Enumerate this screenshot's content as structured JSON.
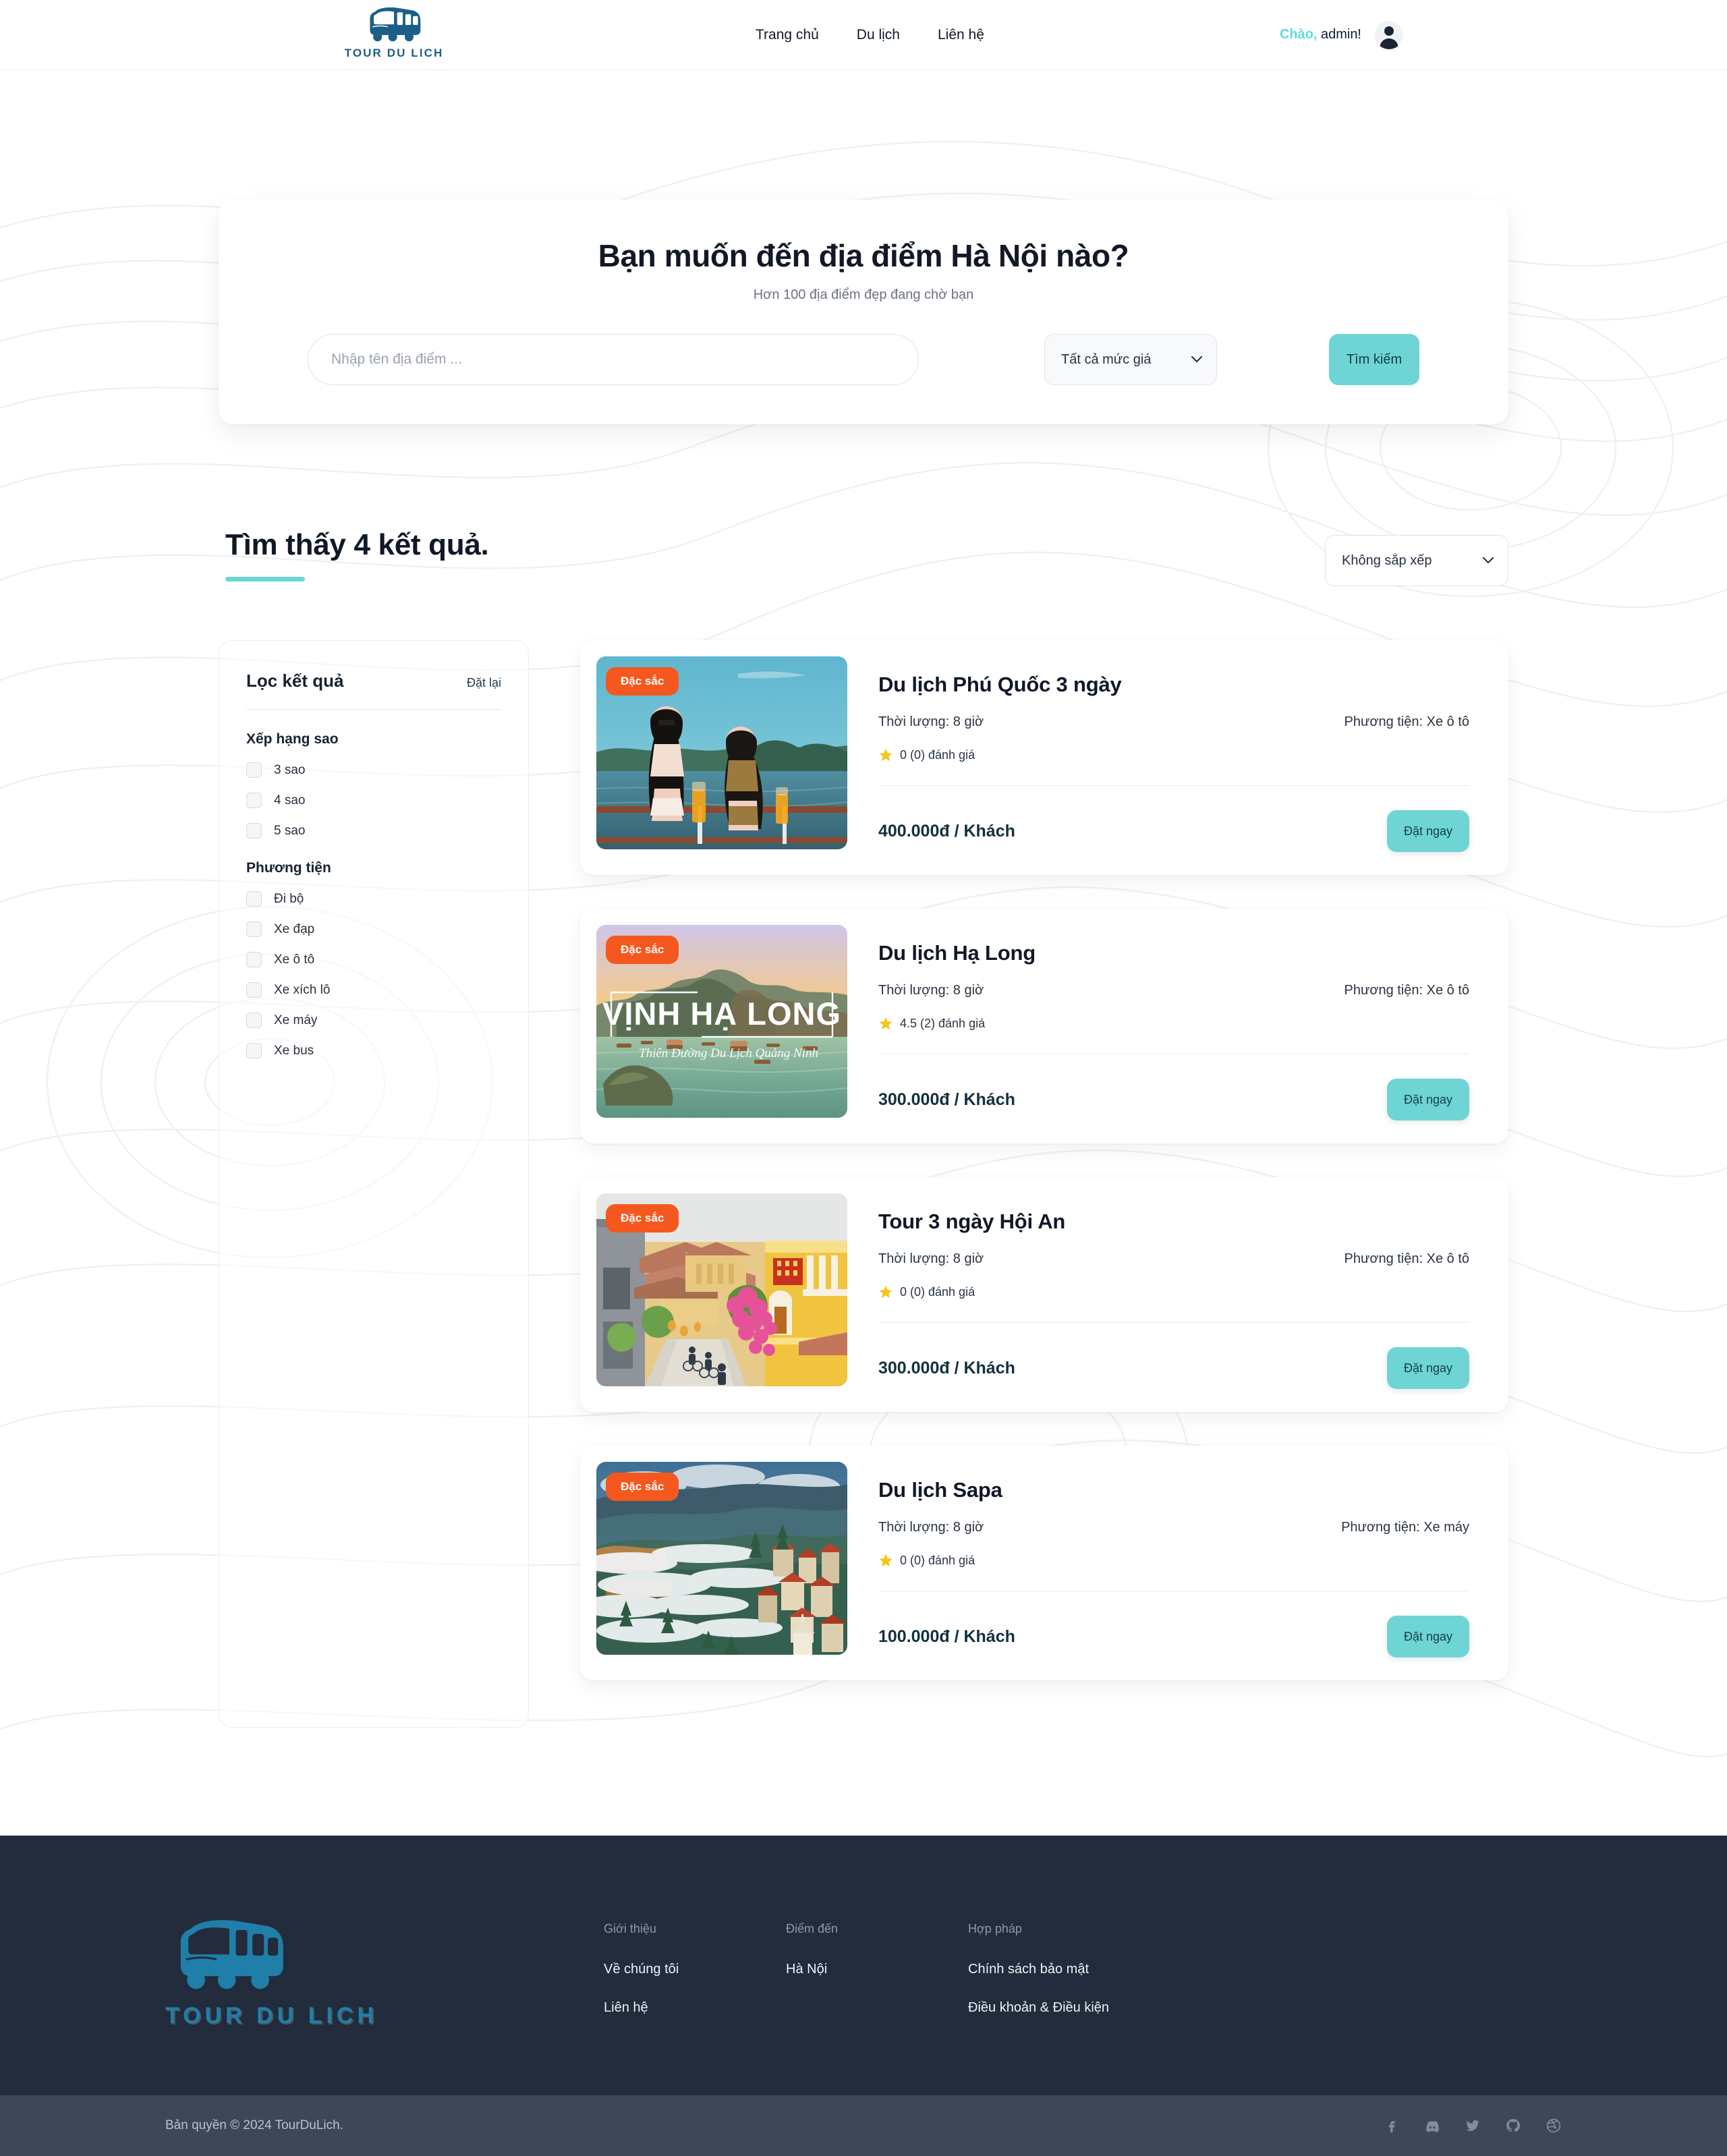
{
  "header": {
    "brand": {
      "word": "TOUR DU LICH",
      "icon": "bus-icon"
    },
    "nav": [
      {
        "label": "Trang chủ",
        "name": "nav-home"
      },
      {
        "label": "Du lịch",
        "name": "nav-travel"
      },
      {
        "label": "Liên hệ",
        "name": "nav-contact"
      }
    ],
    "user": {
      "greeting": "Chào,",
      "username": " admin!",
      "avatar_icon": "user-avatar-icon"
    }
  },
  "hero": {
    "title": "Bạn muốn đến địa điểm Hà Nội nào?",
    "subtitle": "Hơn 100 địa điểm đẹp đang chờ bạn",
    "search_placeholder": "Nhập tên địa điểm ...",
    "search_value": "",
    "price_selected": "Tất cả mức giá",
    "price_options": [
      "Tất cả mức giá"
    ],
    "search_button": "Tìm kiếm"
  },
  "results": {
    "heading": "Tìm thấy 4 kết quả.",
    "sort_selected": "Không sắp xếp",
    "sort_options": [
      "Không sắp xếp"
    ]
  },
  "filters": {
    "title": "Lọc kết quả",
    "reset_label": "Đặt lại",
    "groups": [
      {
        "title": "Xếp hạng sao",
        "options": [
          {
            "label": "3 sao",
            "checked": false
          },
          {
            "label": "4 sao",
            "checked": false
          },
          {
            "label": "5 sao",
            "checked": false
          }
        ]
      },
      {
        "title": "Phương tiện",
        "options": [
          {
            "label": "Đi bộ",
            "checked": false
          },
          {
            "label": "Xe đạp",
            "checked": false
          },
          {
            "label": "Xe ô tô",
            "checked": false
          },
          {
            "label": "Xe xích lô",
            "checked": false
          },
          {
            "label": "Xe máy",
            "checked": false
          },
          {
            "label": "Xe bus",
            "checked": false
          }
        ]
      }
    ]
  },
  "tours": [
    {
      "badge": "Đặc sắc",
      "title": "Du lịch Phú Quốc 3 ngày",
      "duration": "Thời lượng: 8 giờ",
      "transport": "Phương tiện: Xe ô tô",
      "rating": "0 (0) đánh giá",
      "price": "400.000đ / Khách",
      "book_label": "Đặt ngay",
      "image": "phu-quoc-boat-photo",
      "overlay_title": "",
      "overlay_sub": ""
    },
    {
      "badge": "Đặc sắc",
      "title": "Du lịch Hạ Long",
      "duration": "Thời lượng: 8 giờ",
      "transport": "Phương tiện: Xe ô tô",
      "rating": "4.5 (2) đánh giá",
      "price": "300.000đ / Khách",
      "book_label": "Đặt ngay",
      "image": "ha-long-bay-photo",
      "overlay_title": "VỊNH HẠ LONG",
      "overlay_sub": "Thiên Đường Du Lịch Quảng Ninh"
    },
    {
      "badge": "Đặc sắc",
      "title": "Tour 3 ngày Hội An",
      "duration": "Thời lượng: 8 giờ",
      "transport": "Phương tiện: Xe ô tô",
      "rating": "0 (0) đánh giá",
      "price": "300.000đ / Khách",
      "book_label": "Đặt ngay",
      "image": "hoi-an-old-town-photo",
      "overlay_title": "",
      "overlay_sub": ""
    },
    {
      "badge": "Đặc sắc",
      "title": "Du lịch Sapa",
      "duration": "Thời lượng: 8 giờ",
      "transport": "Phương tiện: Xe máy",
      "rating": "0 (0) đánh giá",
      "price": "100.000đ / Khách",
      "book_label": "Đặt ngay",
      "image": "sapa-clouds-photo",
      "overlay_title": "",
      "overlay_sub": ""
    }
  ],
  "footer": {
    "brand_word": "TOUR DU LICH",
    "columns": [
      {
        "title": "Giới thiệu",
        "links": [
          "Về chúng tôi",
          "Liên hệ"
        ]
      },
      {
        "title": "Điểm đến",
        "links": [
          "Hà Nội"
        ]
      },
      {
        "title": "Hợp pháp",
        "links": [
          "Chính sách bảo mật",
          "Điều khoản & Điều kiện"
        ]
      }
    ],
    "copyright": "Bản quyền © 2024 TourDuLich.",
    "socials": [
      "facebook-icon",
      "discord-icon",
      "twitter-icon",
      "github-icon",
      "dribbble-icon"
    ]
  },
  "colors": {
    "accent": "#6ed4d4",
    "badge": "#f4581e",
    "brand_blue": "#1b5f86",
    "footer_bg": "#222c3c",
    "footer_bar_bg": "#3d4758",
    "star": "#f5c518"
  }
}
